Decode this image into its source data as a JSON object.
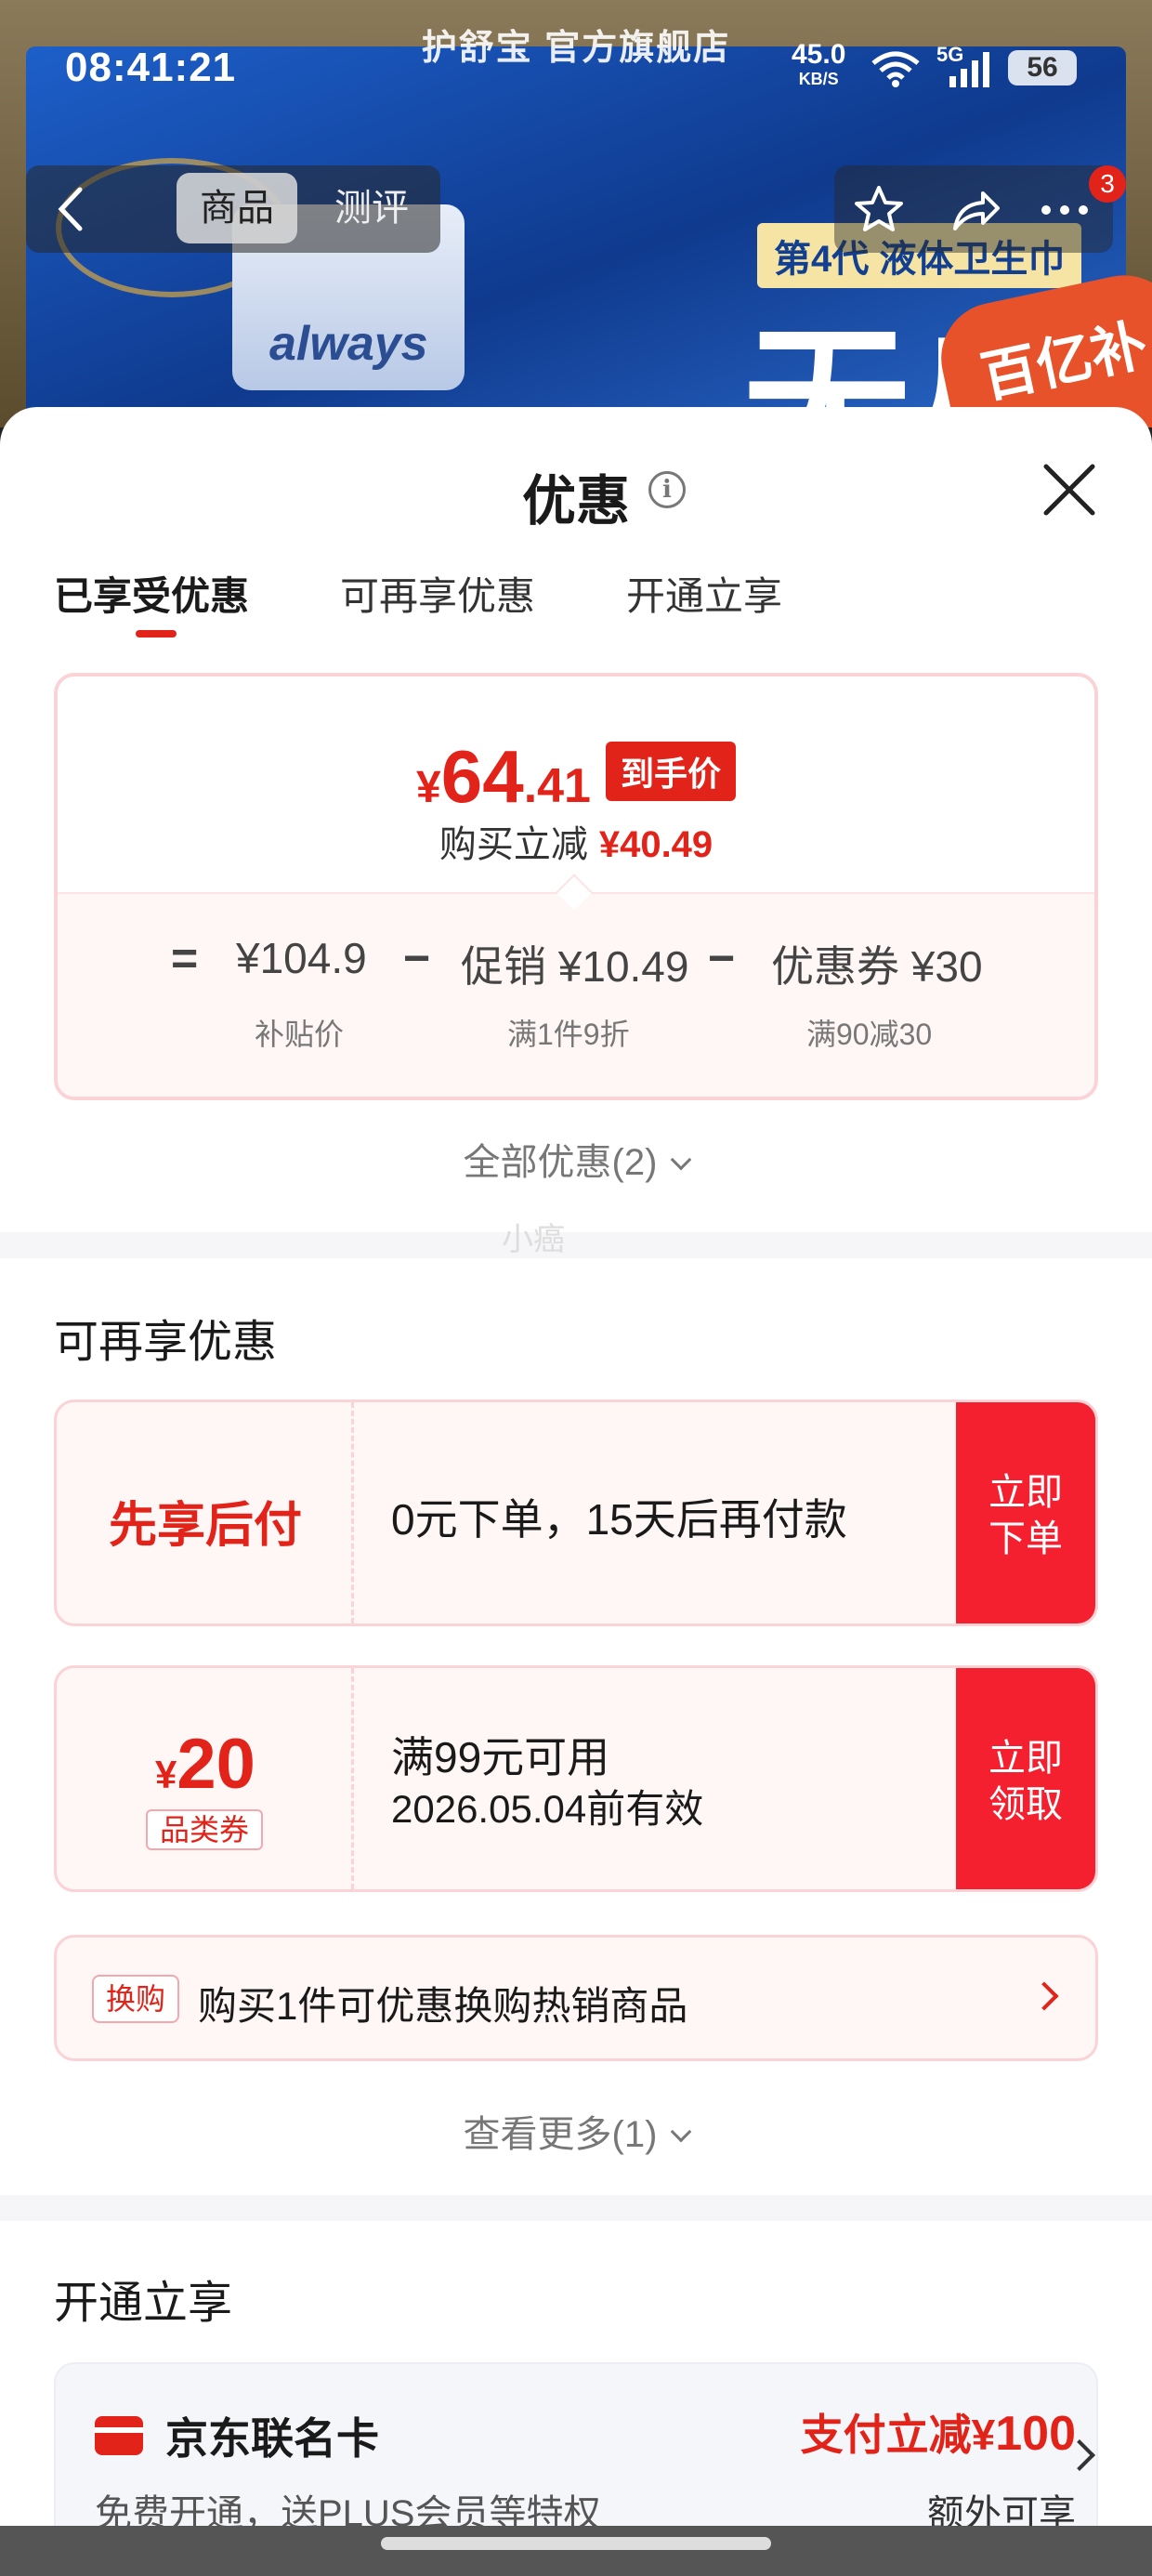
{
  "status_bar": {
    "time": "08:41:21",
    "net_speed": "45.0",
    "net_unit": "KB/S",
    "cell_label": "5G",
    "battery": "56"
  },
  "background": {
    "store_title": "护舒宝 官方旗舰店",
    "product_brand": "always",
    "headline": "第4代 液体卫生巾",
    "big_text": "无感",
    "subsidy_badge": "百亿补贴"
  },
  "nav": {
    "tabs": [
      "商品",
      "测评"
    ],
    "cart_badge": "3"
  },
  "sheet": {
    "title": "优惠",
    "tabs": [
      {
        "label": "已享受优惠",
        "active": true
      },
      {
        "label": "可再享优惠",
        "active": false
      },
      {
        "label": "开通立享",
        "active": false
      }
    ]
  },
  "summary": {
    "currency": "¥",
    "price_int": "64",
    "price_dec": ".41",
    "price_tag": "到手价",
    "saving_label": "购买立减",
    "saving_amount": "¥40.49",
    "equals": "=",
    "minus": "−",
    "items": [
      {
        "value": "¥104.9",
        "sub": "补贴价"
      },
      {
        "value": "促销 ¥10.49",
        "sub": "满1件9折"
      },
      {
        "value": "优惠券 ¥30",
        "sub": "满90减30"
      }
    ],
    "all_link": "全部优惠(2)"
  },
  "watermark": "小癌",
  "more_offers": {
    "title": "可再享优惠",
    "bnpl": {
      "label": "先享后付",
      "text": "0元下单，15天后再付款",
      "button": [
        "立即",
        "下单"
      ]
    },
    "coupon": {
      "currency": "¥",
      "value": "20",
      "category": "品类券",
      "condition": "满99元可用",
      "validity": "2026.05.04前有效",
      "button": [
        "立即",
        "领取"
      ]
    },
    "swap": {
      "tag": "换购",
      "text": "购买1件可优惠换购热销商品"
    },
    "more_link": "查看更多(1)"
  },
  "activate": {
    "title": "开通立享",
    "card": {
      "name": "京东联名卡",
      "desc": "免费开通，送PLUS会员等特权",
      "amount_prefix": "支付立减¥",
      "amount": "100",
      "extra": "额外可享"
    }
  },
  "colors": {
    "accent": "#e2231a",
    "button_red": "#f5202f",
    "card_border": "#fbd3d6",
    "card_bg": "#fff6f6"
  },
  "icons": [
    "back-icon",
    "star-icon",
    "share-icon",
    "more-icon",
    "info-icon",
    "close-icon",
    "chevron-down-icon",
    "chevron-right-icon",
    "credit-card-icon",
    "wifi-icon",
    "signal-icon"
  ]
}
